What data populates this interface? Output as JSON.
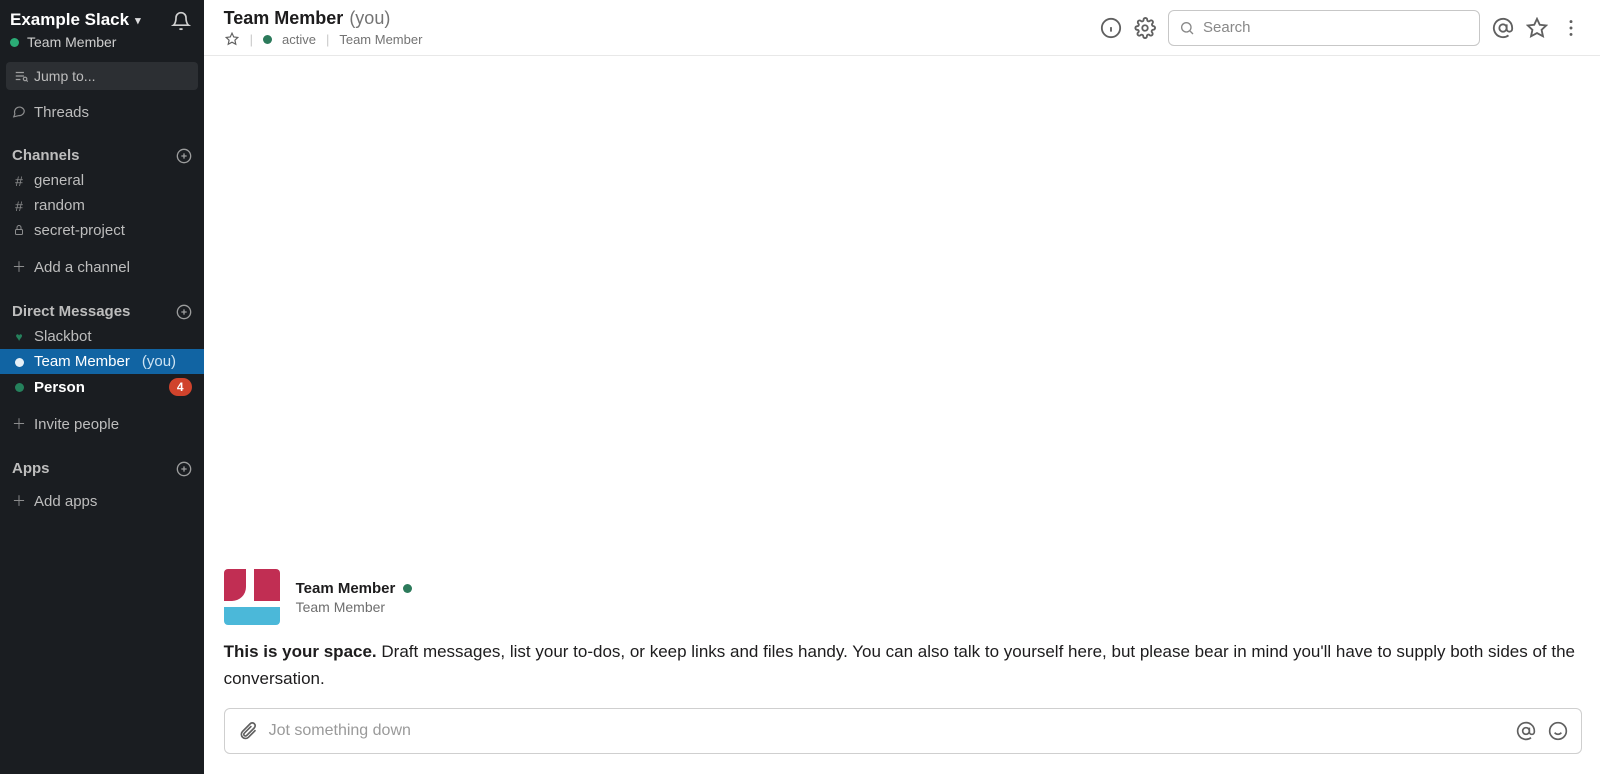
{
  "sidebar": {
    "workspace": "Example Slack",
    "current_user": "Team Member",
    "jump_to": "Jump to...",
    "threads": "Threads",
    "channels_header": "Channels",
    "channels": [
      {
        "name": "general",
        "type": "public"
      },
      {
        "name": "random",
        "type": "public"
      },
      {
        "name": "secret-project",
        "type": "private"
      }
    ],
    "add_channel": "Add a channel",
    "dms_header": "Direct Messages",
    "dms": [
      {
        "name": "Slackbot",
        "presence": "heart"
      },
      {
        "name": "Team Member",
        "presence": "self",
        "suffix": "(you)",
        "selected": true
      },
      {
        "name": "Person",
        "presence": "active",
        "bold": true,
        "badge": "4"
      }
    ],
    "invite_people": "Invite people",
    "apps_header": "Apps",
    "add_apps": "Add apps"
  },
  "header": {
    "name": "Team Member",
    "you": "(you)",
    "status": "active",
    "subtitle_name": "Team Member",
    "search_placeholder": "Search"
  },
  "profile": {
    "name": "Team Member",
    "subtitle": "Team Member"
  },
  "intro": {
    "lead": "This is your space.",
    "body": " Draft messages, list your to-dos, or keep links and files handy. You can also talk to yourself here, but please bear in mind you'll have to supply both sides of the conversation."
  },
  "composer": {
    "placeholder": "Jot something down"
  }
}
